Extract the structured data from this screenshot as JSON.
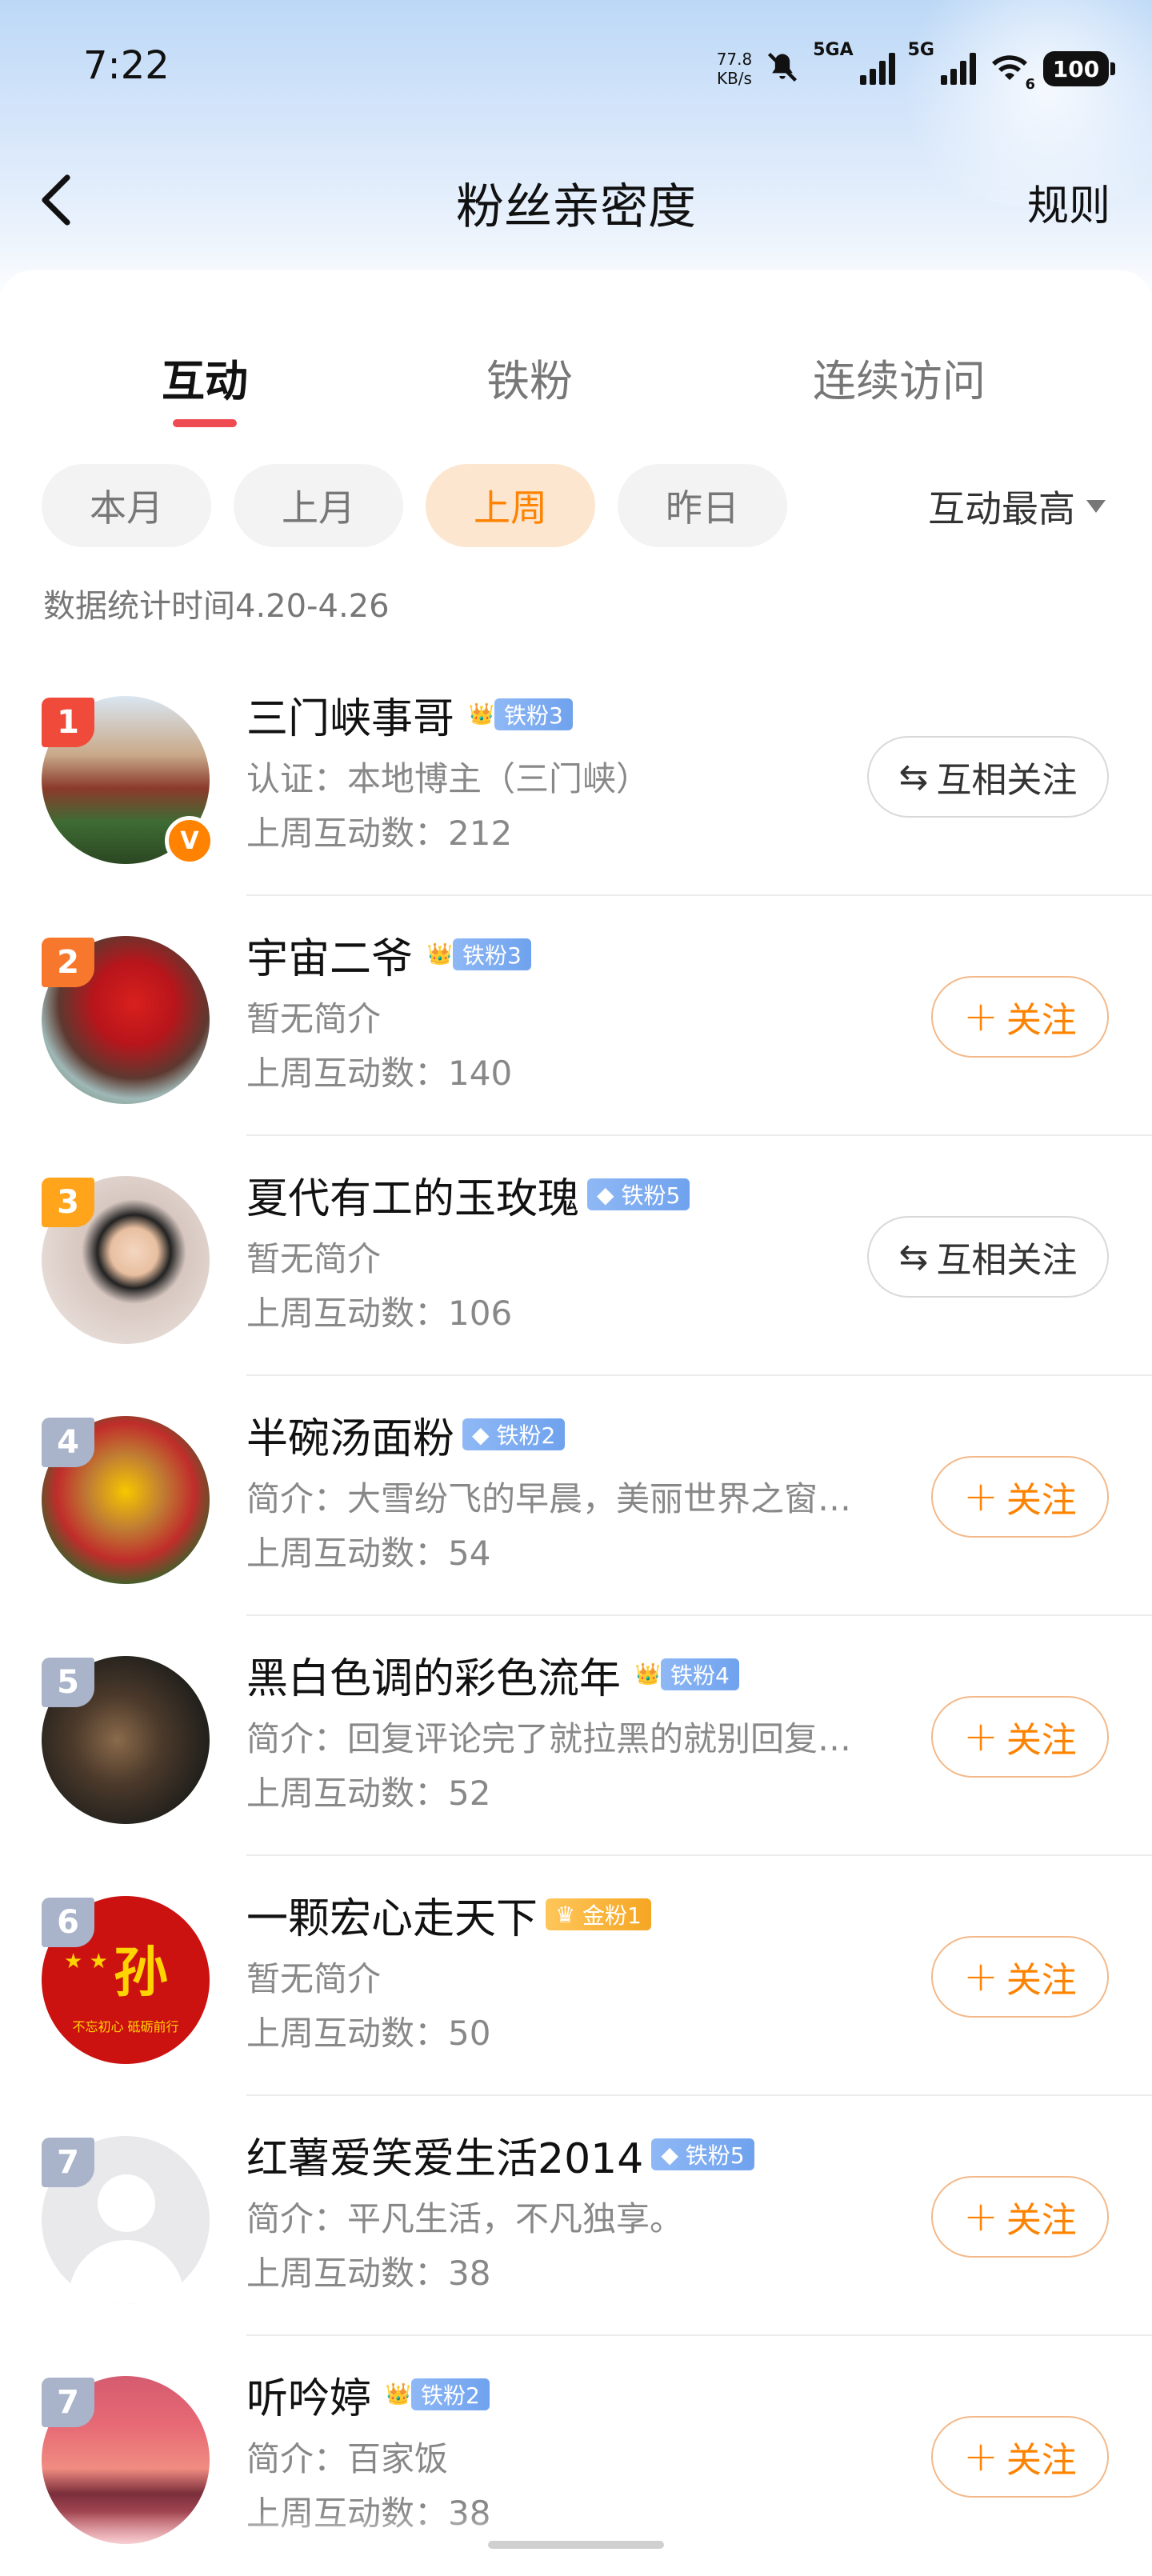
{
  "status_bar": {
    "time": "7:22",
    "net_speed_value": "77.8",
    "net_speed_unit": "KB/s",
    "signal1_label": "5GA",
    "signal2_label": "5G",
    "wifi_label": "6",
    "battery": "100"
  },
  "nav": {
    "title": "粉丝亲密度",
    "rules": "规则",
    "back_icon": "chevron-left-icon"
  },
  "tabs": [
    {
      "label": "互动",
      "active": true
    },
    {
      "label": "铁粉",
      "active": false
    },
    {
      "label": "连续访问",
      "active": false
    }
  ],
  "periods": [
    {
      "label": "本月",
      "active": false
    },
    {
      "label": "上月",
      "active": false
    },
    {
      "label": "上周",
      "active": true
    },
    {
      "label": "昨日",
      "active": false
    }
  ],
  "sort": {
    "label": "互动最高"
  },
  "stat_range": "数据统计时间4.20-4.26",
  "colors": {
    "accent": "#ff8200",
    "tab_underline": "#ee4c52",
    "rank_1": "#f04a3b",
    "rank_2": "#f7782d",
    "rank_3": "#ffa41b",
    "rank_other": "#a9b3c9",
    "fan_tag_blue": "#7aa9f0",
    "fan_tag_gold": "#f5a623"
  },
  "fans": [
    {
      "rank": "1",
      "name": "三门峡事哥",
      "badge_icon": "crown-icon",
      "badge": "铁粉3",
      "badge_style": "blue",
      "bio": "认证：本地博主（三门峡）",
      "count": "上周互动数：212",
      "button": "互相关注",
      "button_type": "mutual",
      "verified": "V"
    },
    {
      "rank": "2",
      "name": "宇宙二爷",
      "badge_icon": "crown-icon",
      "badge": "铁粉3",
      "badge_style": "blue",
      "bio": "暂无简介",
      "count": "上周互动数：140",
      "button": "关注",
      "button_type": "follow"
    },
    {
      "rank": "3",
      "name": "夏代有工的玉玫瑰",
      "badge_icon": "diamond-icon",
      "badge": "铁粉5",
      "badge_style": "blue",
      "bio": "暂无简介",
      "count": "上周互动数：106",
      "button": "互相关注",
      "button_type": "mutual"
    },
    {
      "rank": "4",
      "name": "半碗汤面粉",
      "badge_icon": "diamond-icon",
      "badge": "铁粉2",
      "badge_style": "blue",
      "bio": "简介：大雪纷飞的早晨，美丽世界之窗…",
      "count": "上周互动数：54",
      "button": "关注",
      "button_type": "follow"
    },
    {
      "rank": "5",
      "name": "黑白色调的彩色流年",
      "badge_icon": "crown-icon",
      "badge": "铁粉4",
      "badge_style": "blue",
      "bio": "简介：回复评论完了就拉黑的就别回复…",
      "count": "上周互动数：52",
      "button": "关注",
      "button_type": "follow"
    },
    {
      "rank": "6",
      "name": "一颗宏心走天下",
      "badge_icon": "gold-icon",
      "badge": "金粉1",
      "badge_style": "gold",
      "bio": "暂无简介",
      "count": "上周互动数：50",
      "button": "关注",
      "button_type": "follow",
      "avatar_text": "孙",
      "avatar_caption": "不忘初心 砥砺前行"
    },
    {
      "rank": "7",
      "name": "红薯爱笑爱生活2014",
      "badge_icon": "diamond-icon",
      "badge": "铁粉5",
      "badge_style": "blue",
      "bio": "简介：平凡生活，不凡独享。",
      "count": "上周互动数：38",
      "button": "关注",
      "button_type": "follow"
    },
    {
      "rank": "7",
      "name": "听吟婷",
      "badge_icon": "crown-icon",
      "badge": "铁粉2",
      "badge_style": "blue",
      "bio": "简介：百家饭",
      "count": "上周互动数：38",
      "button": "关注",
      "button_type": "follow"
    }
  ]
}
